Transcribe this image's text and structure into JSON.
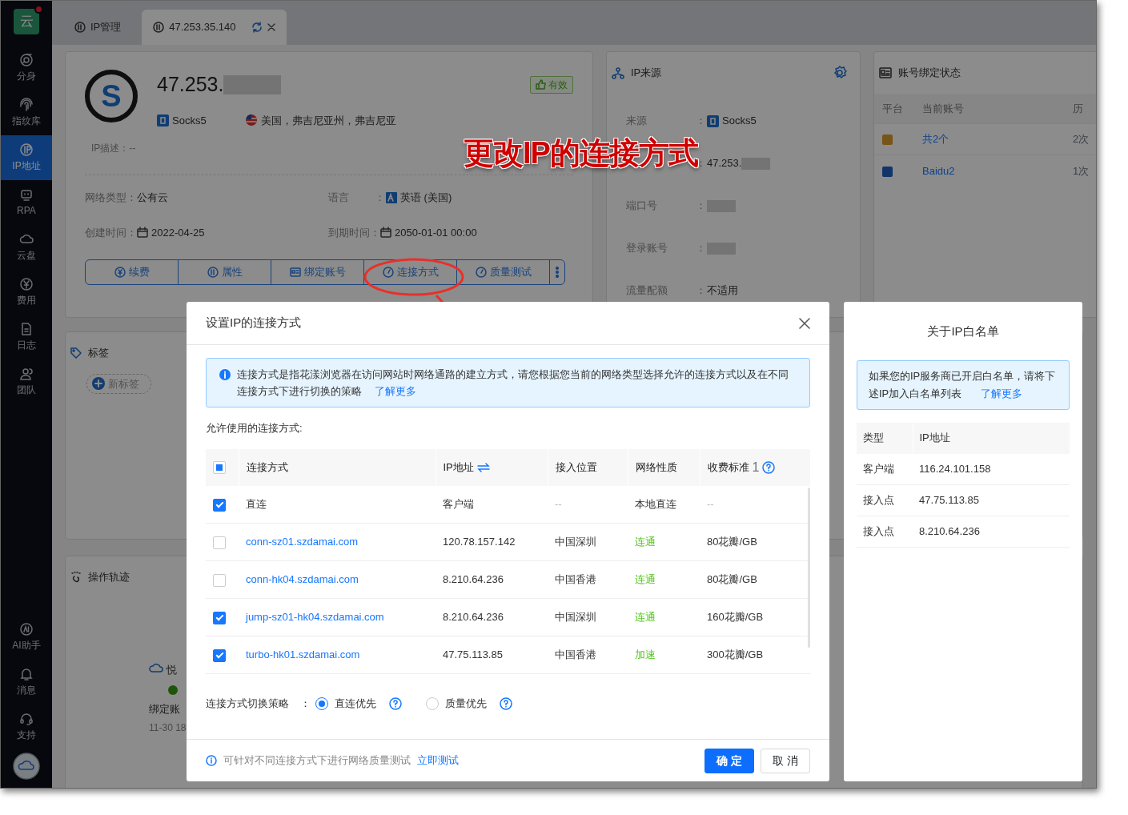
{
  "sidebar": {
    "logo": "云",
    "notification": true,
    "items": [
      {
        "label": "分身",
        "selected": false
      },
      {
        "label": "指纹库",
        "selected": false
      },
      {
        "label": "IP地址",
        "selected": true
      },
      {
        "label": "RPA",
        "selected": false
      },
      {
        "label": "云盘",
        "selected": false
      },
      {
        "label": "费用",
        "selected": false
      },
      {
        "label": "日志",
        "selected": false
      },
      {
        "label": "团队",
        "selected": false
      }
    ],
    "bottom_items": [
      {
        "label": "AI助手"
      },
      {
        "label": "消息"
      },
      {
        "label": "支持"
      }
    ]
  },
  "tabs": [
    {
      "label": "IP管理",
      "selected": false,
      "closable": false
    },
    {
      "label": "47.253.35.140",
      "selected": true,
      "closable": true
    }
  ],
  "ip_card": {
    "badge_letter": "S",
    "ip_prefix": "47.253.",
    "ip_redacted": true,
    "status": "有效",
    "protocol": "Socks5",
    "location": "美国，弗吉尼亚州，弗吉尼亚",
    "description_label": "IP描述：",
    "description": "--",
    "fields": [
      {
        "label": "网络类型：",
        "value": "公有云"
      },
      {
        "label": "语言",
        "colon": "：",
        "value": "英语 (美国)"
      },
      {
        "label": "创建时间：",
        "value": "2022-04-25"
      },
      {
        "label": "到期时间：",
        "value": "2050-01-01 00:00"
      }
    ],
    "actions": [
      "续费",
      "属性",
      "绑定账号",
      "连接方式",
      "质量测试"
    ]
  },
  "ip_source": {
    "title": "IP来源",
    "rows": [
      {
        "label": "来源",
        "value": "Socks5"
      },
      {
        "value": "47.253.",
        "redacted": true
      },
      {
        "label": "端口号",
        "redacted": true
      },
      {
        "label": "登录账号",
        "redacted": true
      },
      {
        "label": "流量配额",
        "value": "不适用"
      }
    ]
  },
  "binding": {
    "title": "账号绑定状态",
    "columns": [
      "平台",
      "当前账号",
      "历"
    ],
    "rows": [
      {
        "account": "共2个",
        "history": "2次"
      },
      {
        "account": "Baidu2",
        "history": "1次"
      }
    ]
  },
  "tags": {
    "title": "标签",
    "add": "新标签"
  },
  "trail": {
    "title": "操作轨迹",
    "event": {
      "name": "悦",
      "action": "绑定账",
      "time": "11-30 18"
    }
  },
  "annotation": {
    "text": "更改IP的连接方式"
  },
  "modal": {
    "title": "设置IP的连接方式",
    "notice": "连接方式是指花漾浏览器在访问网站时网络通路的建立方式，请您根据您当前的网络类型选择允许的连接方式以及在不同连接方式下进行切换的策略",
    "notice_link": "了解更多",
    "allowed_label": "允许使用的连接方式:",
    "table": {
      "select_all_partial": true,
      "columns": [
        "连接方式",
        "IP地址",
        "接入位置",
        "网络性质",
        "收费标准"
      ],
      "header_note": "1",
      "rows": [
        {
          "kind": "direct",
          "checked": true,
          "name": "直连",
          "ip": "客户端",
          "location": "--",
          "network": "本地直连",
          "fee": "--"
        },
        {
          "kind": "relay",
          "checked": false,
          "name": "conn-sz01.szdamai.com",
          "ip": "120.78.157.142",
          "location": "中国深圳",
          "network": "连通",
          "fee": "80花瓣/GB"
        },
        {
          "kind": "relay",
          "checked": false,
          "name": "conn-hk04.szdamai.com",
          "ip": "8.210.64.236",
          "location": "中国香港",
          "network": "连通",
          "fee": "80花瓣/GB"
        },
        {
          "kind": "relay",
          "checked": true,
          "name": "jump-sz01-hk04.szdamai.com",
          "ip": "8.210.64.236",
          "location": "中国深圳",
          "network": "连通",
          "fee": "160花瓣/GB"
        },
        {
          "kind": "relay",
          "checked": true,
          "name": "turbo-hk01.szdamai.com",
          "ip": "47.75.113.85",
          "location": "中国香港",
          "network": "加速",
          "fee": "300花瓣/GB"
        }
      ]
    },
    "strategy": {
      "label": "连接方式切换策略",
      "colon": "：",
      "options": [
        {
          "label": "直连优先",
          "selected": true
        },
        {
          "label": "质量优先",
          "selected": false
        }
      ]
    },
    "footer_hint": "可针对不同连接方式下进行网络质量测试",
    "footer_link": "立即测试",
    "buttons": [
      {
        "label": "确 定",
        "kind": "primary"
      },
      {
        "label": "取 消",
        "kind": "default"
      }
    ]
  },
  "whitelist": {
    "title": "关于IP白名单",
    "notice": "如果您的IP服务商已开启白名单，请将下述IP加入白名单列表",
    "notice_link": "了解更多",
    "columns": [
      "类型",
      "IP地址"
    ],
    "rows": [
      {
        "type": "客户端",
        "ip": "116.24.101.158"
      },
      {
        "type": "接入点",
        "ip": "47.75.113.85"
      },
      {
        "type": "接入点",
        "ip": "8.210.64.236"
      }
    ]
  }
}
